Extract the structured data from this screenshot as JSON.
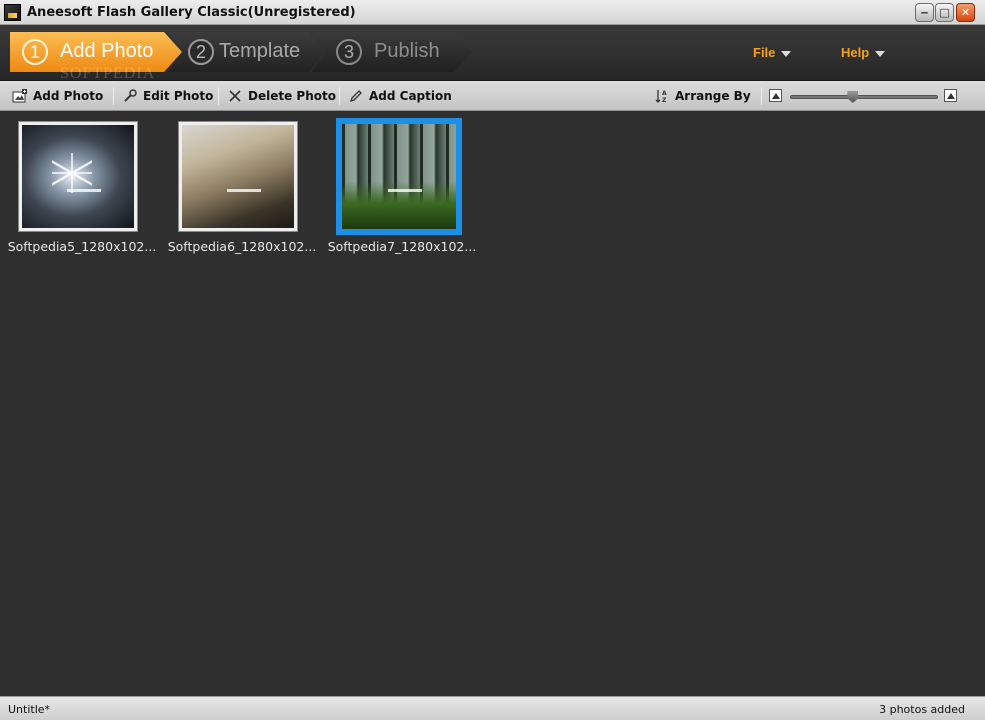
{
  "window": {
    "title": "Aneesoft Flash Gallery Classic(Unregistered)",
    "controls": {
      "minimize": "‒",
      "maximize": "□",
      "close": "✕"
    }
  },
  "wizard": {
    "steps": [
      {
        "number": "1",
        "label": "Add Photo",
        "active": true
      },
      {
        "number": "2",
        "label": "Template",
        "active": false
      },
      {
        "number": "3",
        "label": "Publish",
        "active": false
      }
    ],
    "watermark": "SOFTPEDIA",
    "menus": [
      {
        "label": "File"
      },
      {
        "label": "Help"
      }
    ],
    "accent_color": "#f5a21a"
  },
  "toolbar": {
    "add_photo": "Add Photo",
    "edit_photo": "Edit Photo",
    "delete_photo": "Delete Photo",
    "add_caption": "Add Caption",
    "arrange_by": "Arrange By",
    "thumbnail_size_fraction": 0.42
  },
  "photos": [
    {
      "name": "Softpedia5_1280x102...",
      "selected": false,
      "style": "frost"
    },
    {
      "name": "Softpedia6_1280x102...",
      "selected": false,
      "style": "fog"
    },
    {
      "name": "Softpedia7_1280x102...",
      "selected": true,
      "style": "forest",
      "selection_color": "#1e8fe6"
    }
  ],
  "status": {
    "document": "Untitle*",
    "count_text": "3 photos added"
  }
}
